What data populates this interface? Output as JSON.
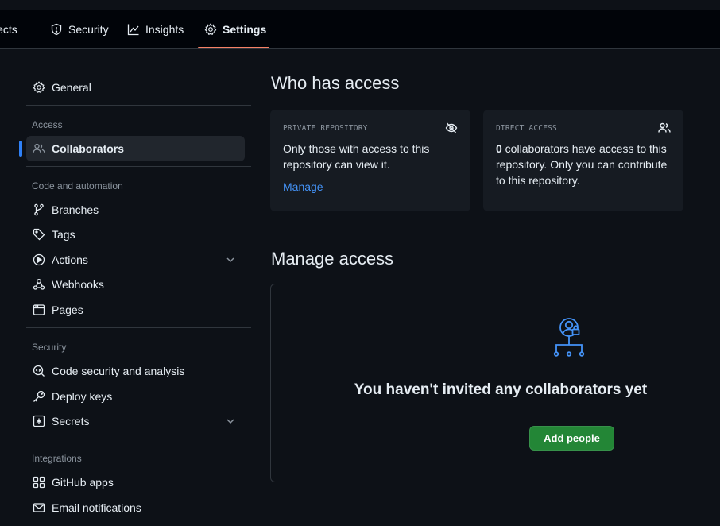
{
  "topbar": {
    "tabs": [
      {
        "label": "jects",
        "icon": "table-icon"
      },
      {
        "label": "Security",
        "icon": "shield-icon"
      },
      {
        "label": "Insights",
        "icon": "graph-icon"
      },
      {
        "label": "Settings",
        "icon": "gear-icon",
        "selected": true
      }
    ],
    "accent_color": "#f78166"
  },
  "sidebar": {
    "general": "General",
    "groups": {
      "access": "Access",
      "code_automation": "Code and automation",
      "security": "Security",
      "integrations": "Integrations"
    },
    "items": {
      "collaborators": "Collaborators",
      "branches": "Branches",
      "tags": "Tags",
      "actions": "Actions",
      "webhooks": "Webhooks",
      "pages": "Pages",
      "code_security": "Code security and analysis",
      "deploy_keys": "Deploy keys",
      "secrets": "Secrets",
      "github_apps": "GitHub apps",
      "email_notifications": "Email notifications"
    },
    "active_item": "collaborators"
  },
  "main": {
    "who_has_access": {
      "title": "Who has access",
      "private_card": {
        "label": "PRIVATE REPOSITORY",
        "icon": "eye-closed-icon",
        "text": "Only those with access to this repository can view it.",
        "link": "Manage"
      },
      "direct_card": {
        "label": "DIRECT ACCESS",
        "icon": "people-icon",
        "count": "0",
        "text": " collaborators have access to this repository. Only you can contribute to this repository."
      }
    },
    "manage_access": {
      "title": "Manage access",
      "empty_message": "You haven't invited any collaborators yet",
      "add_button": "Add people",
      "illustration_icon": "person-lock-tree-icon"
    }
  },
  "colors": {
    "background": "#0d1117",
    "card": "#161b22",
    "border": "#30363d",
    "link": "#4493f8",
    "primary_button": "#238636",
    "active_indicator": "#2f81f7"
  }
}
